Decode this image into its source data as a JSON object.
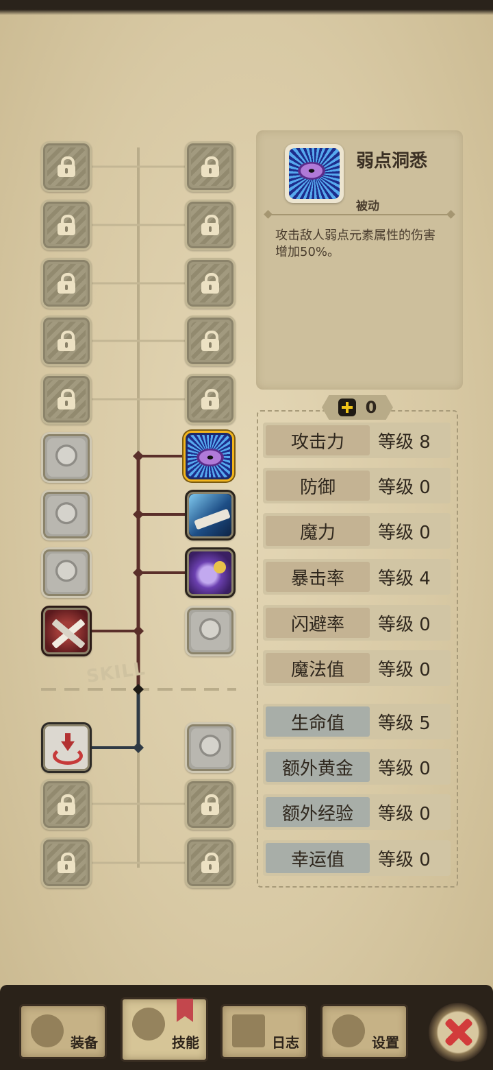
{
  "tree": {
    "section_label": "SKILL"
  },
  "detail": {
    "skill_name": "弱点洞悉",
    "skill_type": "被动",
    "description": "攻击敌人弱点元素属性的伤害增加50%。"
  },
  "points": {
    "available": "0"
  },
  "attributes": [
    {
      "label": "攻击力",
      "level": "等级 8"
    },
    {
      "label": "防御",
      "level": "等级 0"
    },
    {
      "label": "魔力",
      "level": "等级 0"
    },
    {
      "label": "暴击率",
      "level": "等级 4"
    },
    {
      "label": "闪避率",
      "level": "等级 0"
    },
    {
      "label": "魔法值",
      "level": "等级 0"
    },
    {
      "label": "生命值",
      "level": "等级 5"
    },
    {
      "label": "额外黄金",
      "level": "等级 0"
    },
    {
      "label": "额外经验",
      "level": "等级 0"
    },
    {
      "label": "幸运值",
      "level": "等级 0"
    }
  ],
  "nav": {
    "tabs": [
      {
        "label": "装备",
        "icon": "axe-icon"
      },
      {
        "label": "技能",
        "icon": "skill-ring-icon"
      },
      {
        "label": "日志",
        "icon": "journal-icon"
      },
      {
        "label": "设置",
        "icon": "gear-icon"
      }
    ],
    "close_icon": "close-icon"
  },
  "colors": {
    "selected_highlight": "#f2b51c",
    "connector_active": "#5a2f2a",
    "connector_inactive": "#b9ac8a",
    "close_red": "#d23b3b"
  }
}
